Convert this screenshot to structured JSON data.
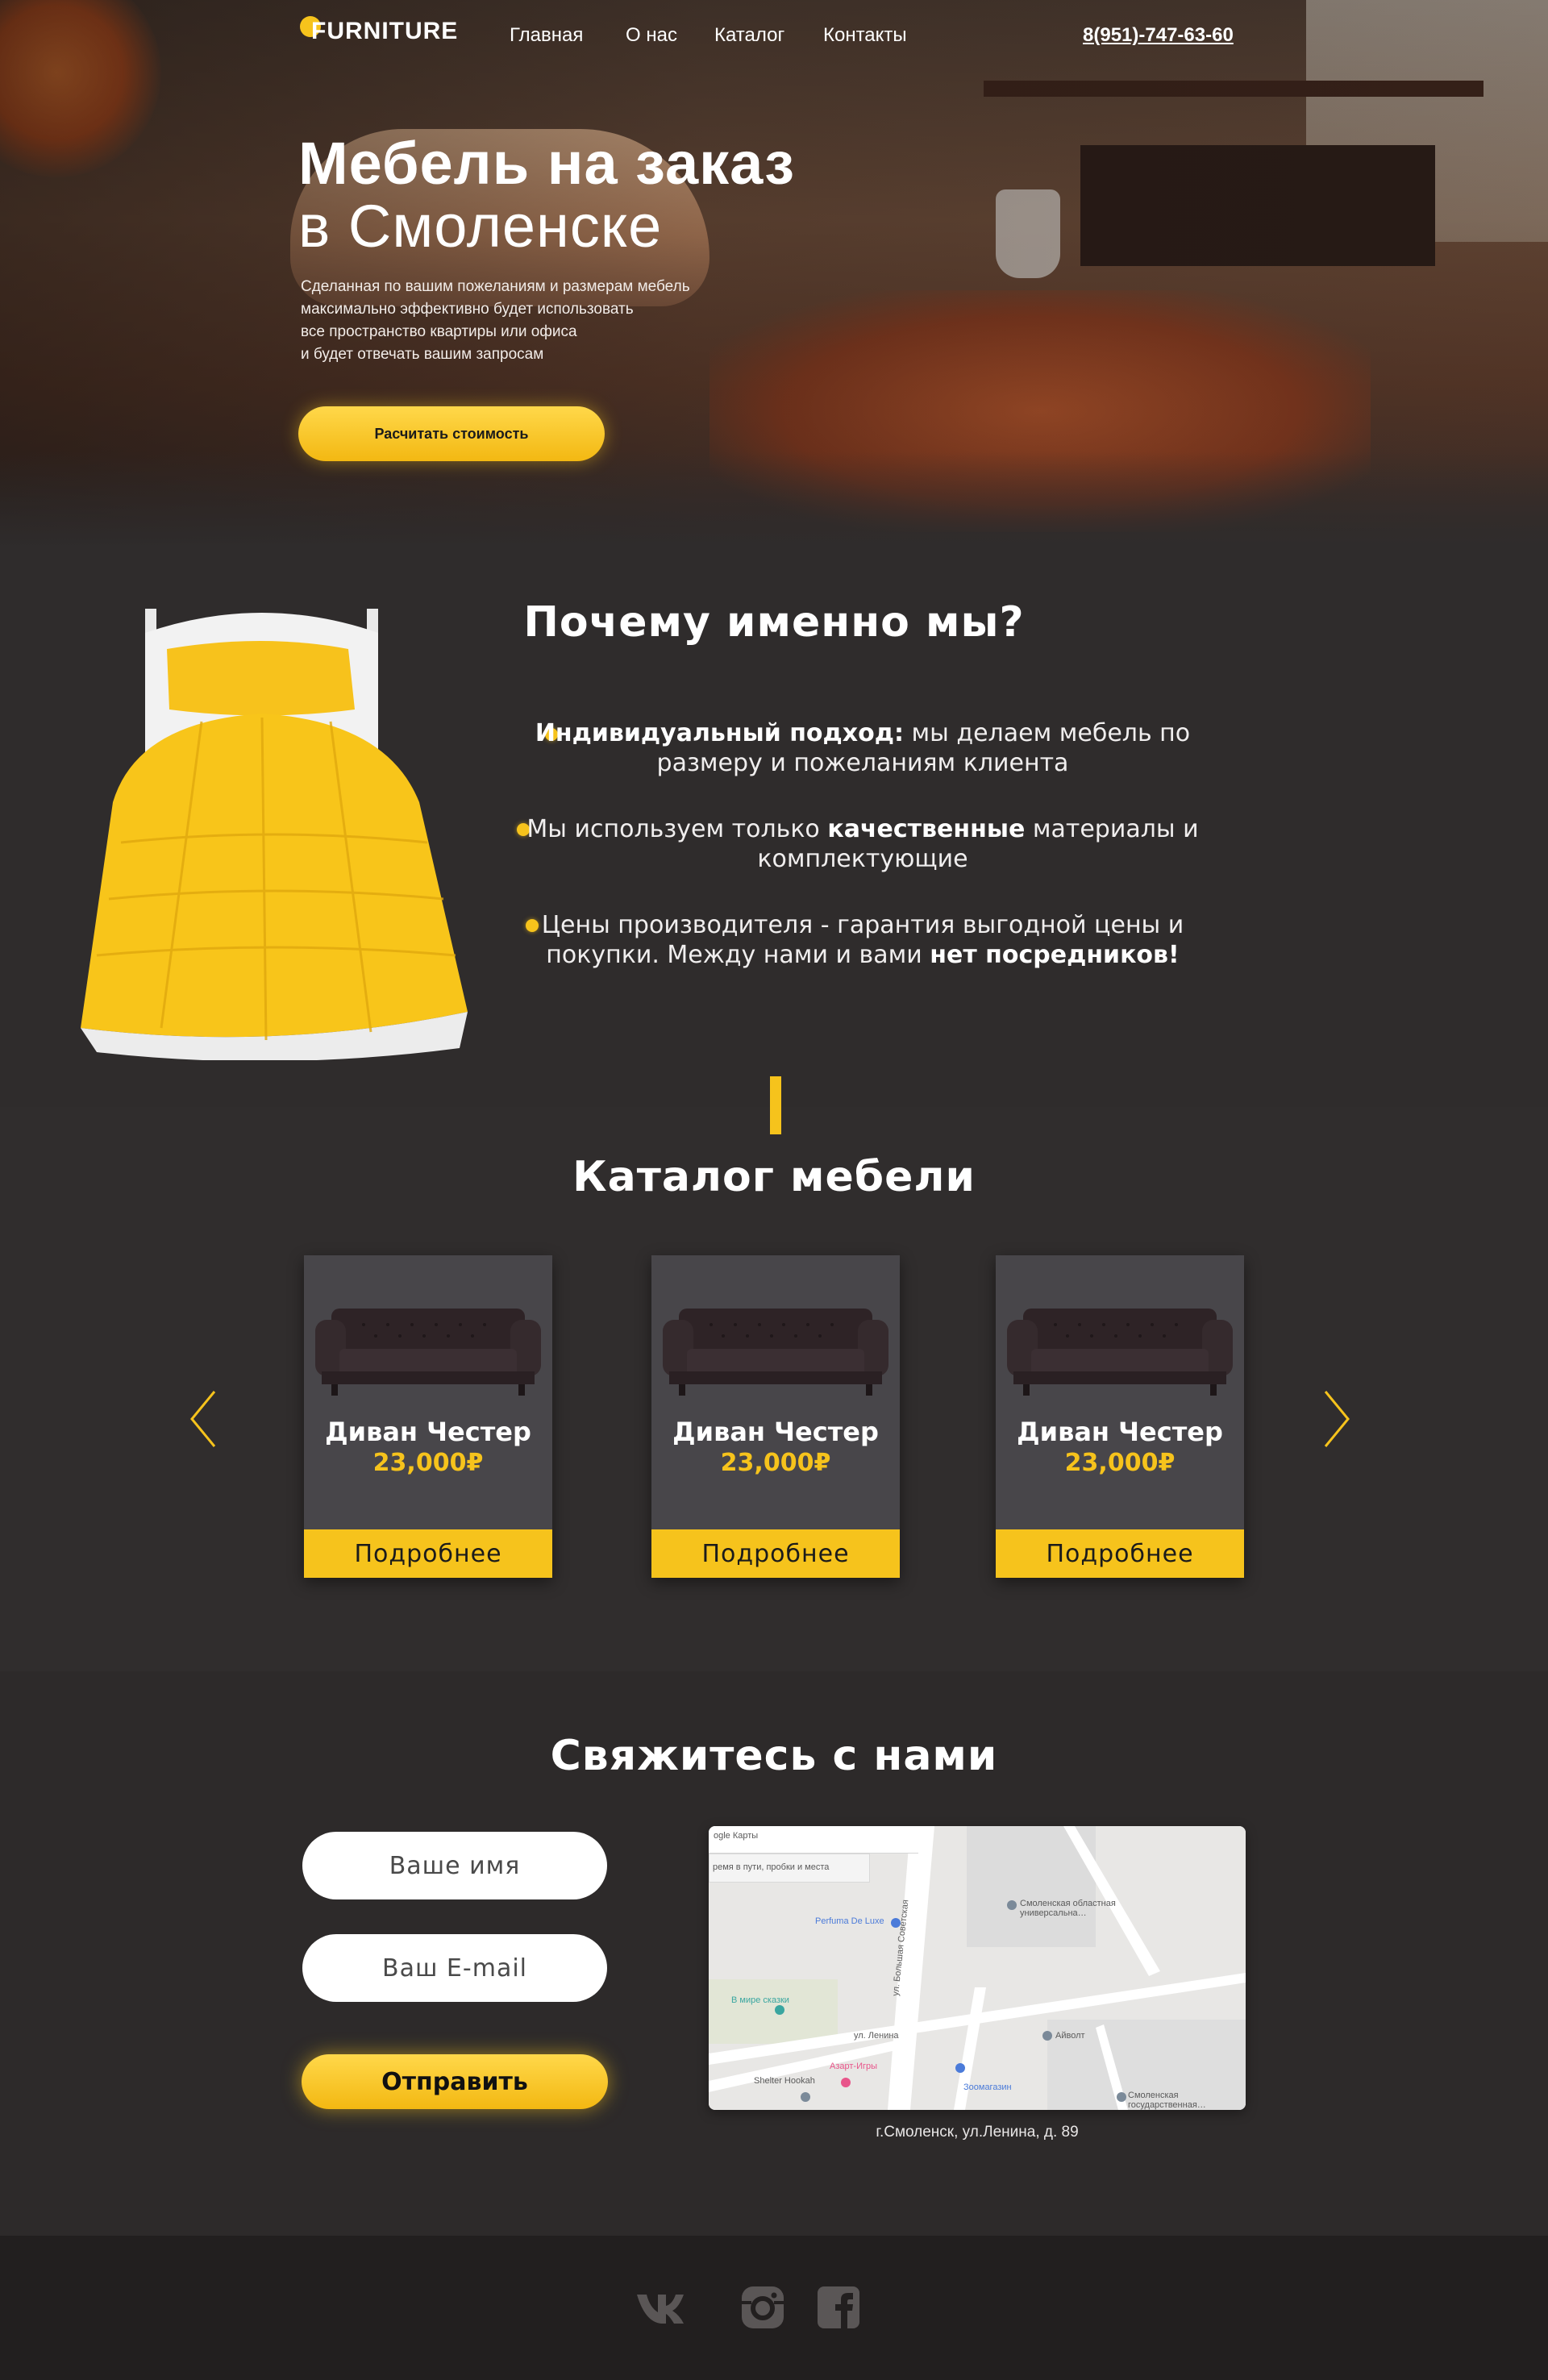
{
  "brand": {
    "logo_text": "FURNITURE",
    "accent_color": "#f6c31c",
    "background_color": "#2f2c2c"
  },
  "nav": {
    "items": [
      {
        "label": "Главная"
      },
      {
        "label": "О нас"
      },
      {
        "label": "Каталог"
      },
      {
        "label": "Контакты"
      }
    ],
    "phone": "8(951)-747-63-60"
  },
  "hero": {
    "title_line1": "Мебель на заказ",
    "title_line2": "в Смоленске",
    "description_lines": [
      "Сделанная по вашим пожеланиям и размерам мебель",
      "максимально эффективно будет использовать",
      "все пространство квартиры или офиса",
      "и будет отвечать вашим запросам"
    ],
    "cta_label": "Расчитать стоимость"
  },
  "why": {
    "title": "Почему именно мы?",
    "items": [
      {
        "bold_lead": "Индивидуальный подход:",
        "text_after": " мы делаем мебель по размеру и пожеланиям клиента"
      },
      {
        "text_before": "Мы используем только ",
        "bold": "качественные",
        "text_after": " материалы и комплектующие"
      },
      {
        "text_before": "Цены производителя - гарантия выгодной цены и покупки. Между нами и вами ",
        "bold": "нет посредников!"
      }
    ]
  },
  "catalog": {
    "title": "Каталог мебели",
    "prev_icon": "chevron-left-icon",
    "next_icon": "chevron-right-icon",
    "cards": [
      {
        "name": "Диван Честер",
        "price": "23,000₽",
        "button": "Подробнее"
      },
      {
        "name": "Диван Честер",
        "price": "23,000₽",
        "button": "Подробнее"
      },
      {
        "name": "Диван Честер",
        "price": "23,000₽",
        "button": "Подробнее"
      }
    ]
  },
  "contact": {
    "title": "Свяжитесь с нами",
    "name_placeholder": "Ваше имя",
    "email_placeholder": "Ваш E-mail",
    "submit_label": "Отправить",
    "address": "г.Смоленск, ул.Ленина, д. 89",
    "map_labels": {
      "search_hint": "ogle Карты",
      "route_hint": "ремя в пути, пробки и места",
      "place1": "Perfuma De Luxe",
      "place2": "В мире сказки",
      "place3": "Смоленская областная универсальна…",
      "place4": "Айволт",
      "place5": "Shelter Hookah",
      "place6": "Азарт-Игры",
      "place7": "Зоомагазин",
      "place8": "Смоленская государственная…",
      "street1": "ул. Ленина",
      "street2": "ул. Большая Советская"
    }
  },
  "footer": {
    "social": [
      {
        "icon": "vk-icon"
      },
      {
        "icon": "instagram-icon"
      },
      {
        "icon": "facebook-icon"
      }
    ]
  }
}
